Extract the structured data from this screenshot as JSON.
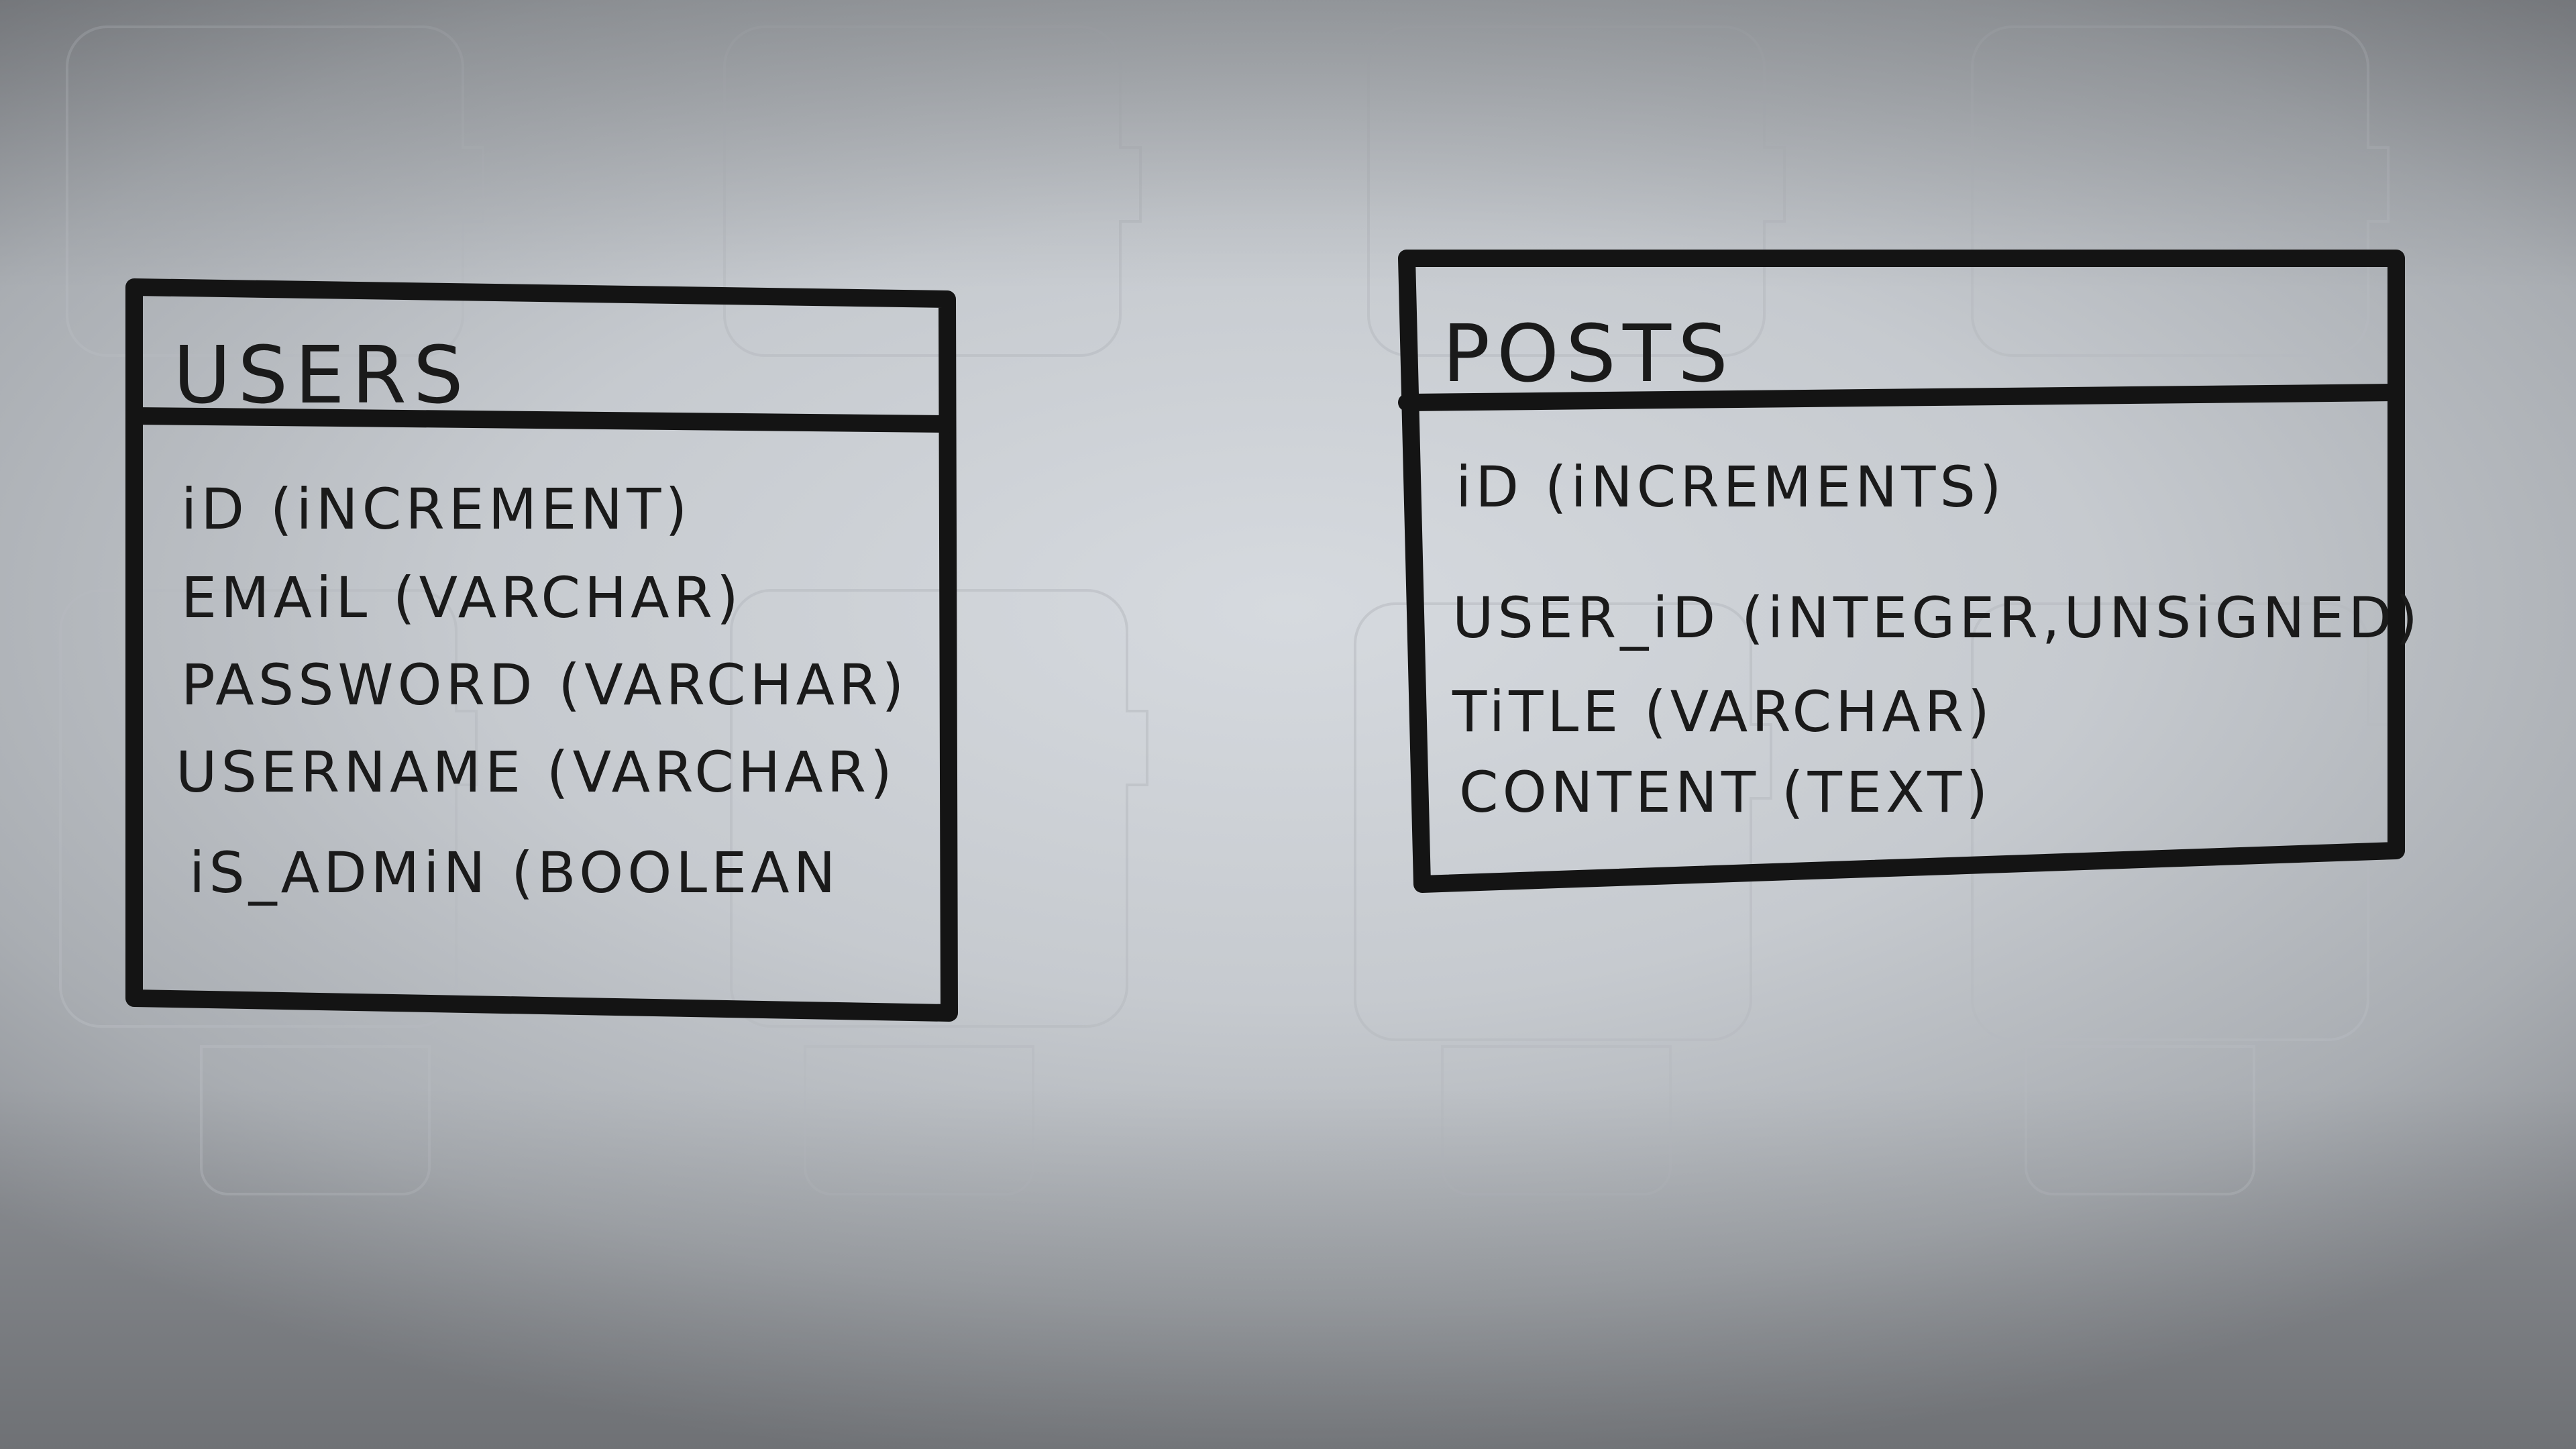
{
  "diagram": {
    "tables": [
      {
        "name": "USERS",
        "fields": [
          "iD (iNCREMENT)",
          "EMAiL (VARCHAR)",
          "PASSWORD (VARCHAR)",
          "USERNAME (VARCHAR)",
          "iS_ADMiN (BOOLEAN"
        ]
      },
      {
        "name": "POSTS",
        "fields": [
          "iD (iNCREMENTS)",
          "USER_iD (iNTEGER,UNSiGNED)",
          "TiTLE (VARCHAR)",
          "CONTENT (TEXT)"
        ]
      }
    ]
  },
  "colors": {
    "ink": "#141414",
    "paper": "#c8ccd1"
  }
}
